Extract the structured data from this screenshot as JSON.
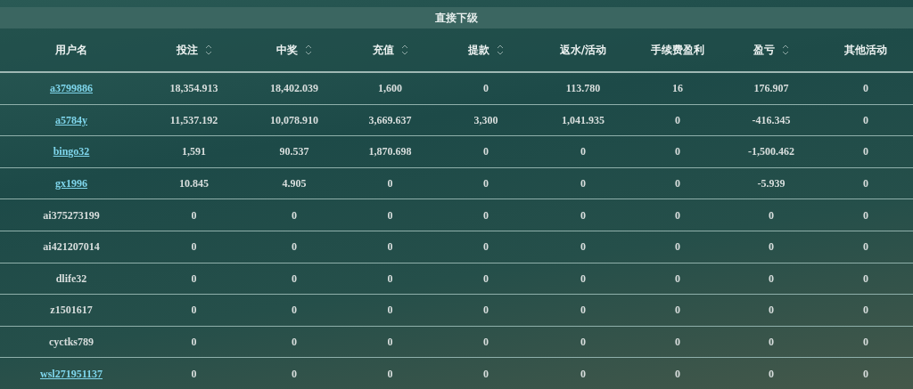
{
  "title": "直接下级",
  "columns": [
    {
      "label": "用户名",
      "sortable": false
    },
    {
      "label": "投注",
      "sortable": true
    },
    {
      "label": "中奖",
      "sortable": true
    },
    {
      "label": "充值",
      "sortable": true
    },
    {
      "label": "提款",
      "sortable": true
    },
    {
      "label": "返水/活动",
      "sortable": false
    },
    {
      "label": "手续费盈利",
      "sortable": false
    },
    {
      "label": "盈亏",
      "sortable": true
    },
    {
      "label": "其他活动",
      "sortable": false
    }
  ],
  "rows": [
    {
      "user": "a3799886",
      "link": true,
      "cells": [
        "18,354.913",
        "18,402.039",
        "1,600",
        "0",
        "113.780",
        "16",
        "176.907",
        "0"
      ]
    },
    {
      "user": "a5784y",
      "link": true,
      "cells": [
        "11,537.192",
        "10,078.910",
        "3,669.637",
        "3,300",
        "1,041.935",
        "0",
        "-416.345",
        "0"
      ]
    },
    {
      "user": "bingo32",
      "link": true,
      "cells": [
        "1,591",
        "90.537",
        "1,870.698",
        "0",
        "0",
        "0",
        "-1,500.462",
        "0"
      ]
    },
    {
      "user": "gx1996",
      "link": true,
      "cells": [
        "10.845",
        "4.905",
        "0",
        "0",
        "0",
        "0",
        "-5.939",
        "0"
      ]
    },
    {
      "user": "ai375273199",
      "link": false,
      "cells": [
        "0",
        "0",
        "0",
        "0",
        "0",
        "0",
        "0",
        "0"
      ]
    },
    {
      "user": "ai421207014",
      "link": false,
      "cells": [
        "0",
        "0",
        "0",
        "0",
        "0",
        "0",
        "0",
        "0"
      ]
    },
    {
      "user": "dlife32",
      "link": false,
      "cells": [
        "0",
        "0",
        "0",
        "0",
        "0",
        "0",
        "0",
        "0"
      ]
    },
    {
      "user": "z1501617",
      "link": false,
      "cells": [
        "0",
        "0",
        "0",
        "0",
        "0",
        "0",
        "0",
        "0"
      ]
    },
    {
      "user": "cyctks789",
      "link": false,
      "cells": [
        "0",
        "0",
        "0",
        "0",
        "0",
        "0",
        "0",
        "0"
      ]
    },
    {
      "user": "wsl271951137",
      "link": true,
      "cells": [
        "0",
        "0",
        "0",
        "0",
        "0",
        "0",
        "0",
        "0"
      ]
    }
  ]
}
